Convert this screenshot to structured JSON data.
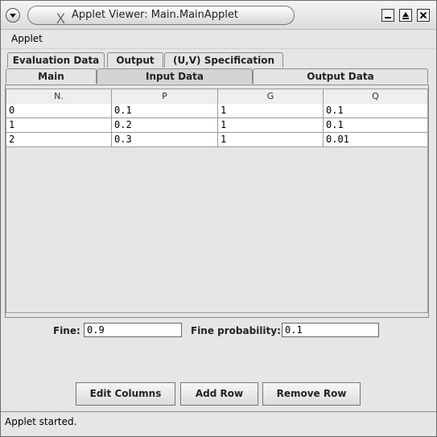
{
  "window": {
    "title": "Applet Viewer: Main.MainApplet"
  },
  "menubar": {
    "applet_label": "Applet"
  },
  "tabs_back": [
    "Evaluation Data",
    "Output",
    "(U,V) Specification"
  ],
  "tabs_front": [
    "Main",
    "Input Data",
    "Output Data"
  ],
  "selected_tab": "Input Data",
  "table": {
    "columns": [
      "N.",
      "P",
      "G",
      "Q"
    ],
    "rows": [
      [
        "0",
        "0.1",
        "1",
        "0.1"
      ],
      [
        "1",
        "0.2",
        "1",
        "0.1"
      ],
      [
        "2",
        "0.3",
        "1",
        "0.01"
      ]
    ]
  },
  "fields": {
    "fine_label": "Fine:",
    "fine_value": "0.9",
    "fine_prob_label": "Fine probability:",
    "fine_prob_value": "0.1"
  },
  "buttons": {
    "edit_columns": "Edit Columns",
    "add_row": "Add Row",
    "remove_row": "Remove Row"
  },
  "status": "Applet started."
}
